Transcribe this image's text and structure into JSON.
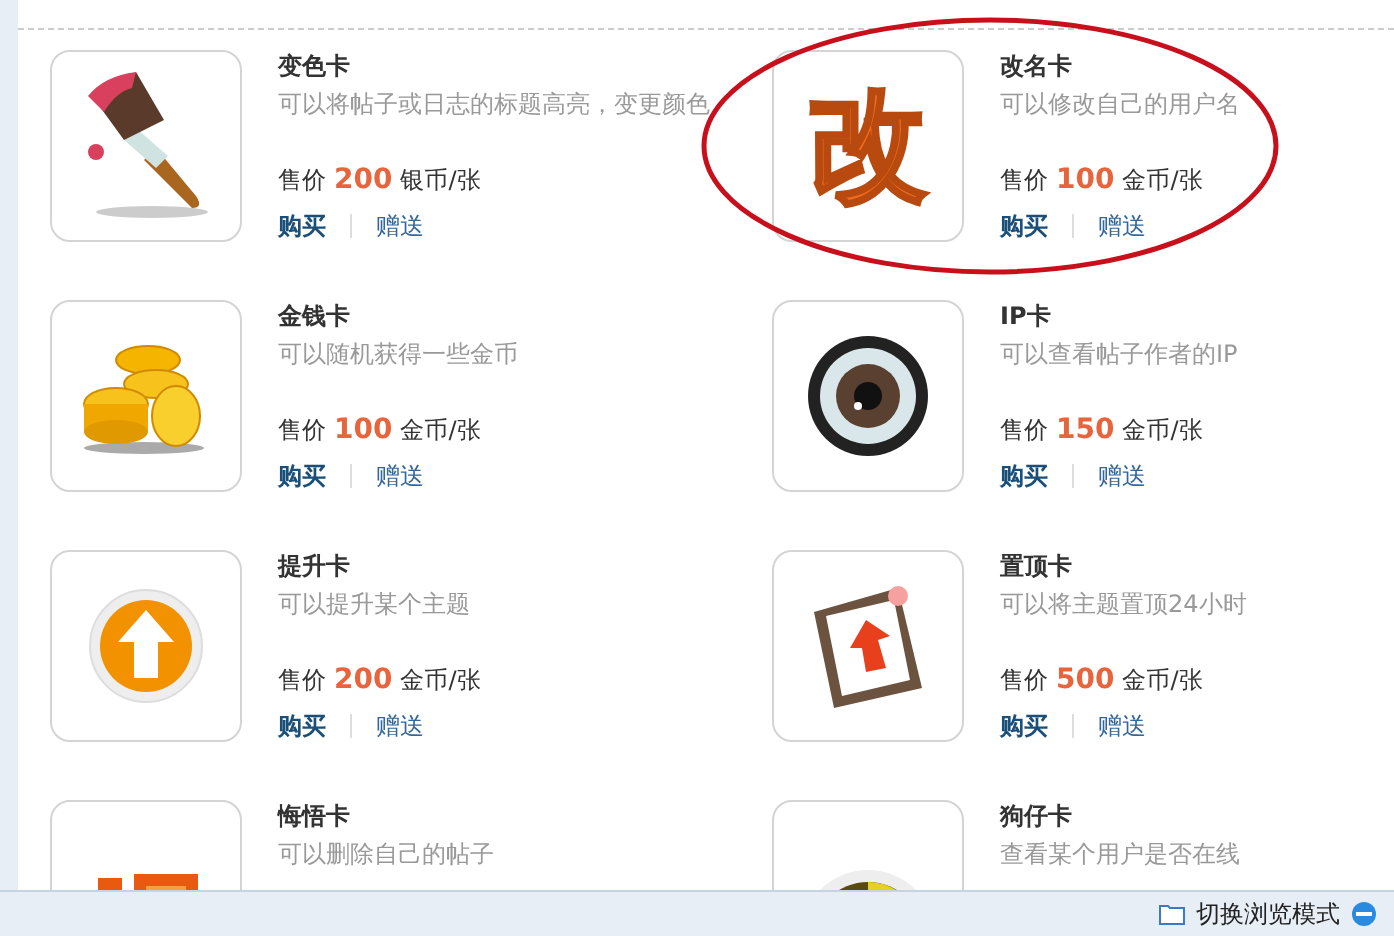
{
  "cards": [
    {
      "kind": "brush",
      "name": "变色卡",
      "description": "可以将帖子或日志的标题高亮，变更颜色",
      "price_label": "售价",
      "price": "200",
      "unit": "银币/张",
      "buy": "购买",
      "gift": "赠送"
    },
    {
      "kind": "glyph",
      "glyph": "改",
      "name": "改名卡",
      "description": "可以修改自己的用户名",
      "price_label": "售价",
      "price": "100",
      "unit": "金币/张",
      "buy": "购买",
      "gift": "赠送",
      "circled": true
    },
    {
      "kind": "coins",
      "name": "金钱卡",
      "description": "可以随机获得一些金币",
      "price_label": "售价",
      "price": "100",
      "unit": "金币/张",
      "buy": "购买",
      "gift": "赠送"
    },
    {
      "kind": "eye",
      "name": "IP卡",
      "description": "可以查看帖子作者的IP",
      "price_label": "售价",
      "price": "150",
      "unit": "金币/张",
      "buy": "购买",
      "gift": "赠送"
    },
    {
      "kind": "arrow",
      "name": "提升卡",
      "description": "可以提升某个主题",
      "price_label": "售价",
      "price": "200",
      "unit": "金币/张",
      "buy": "购买",
      "gift": "赠送"
    },
    {
      "kind": "note",
      "name": "置顶卡",
      "description": "可以将主题置顶24小时",
      "price_label": "售价",
      "price": "500",
      "unit": "金币/张",
      "buy": "购买",
      "gift": "赠送"
    },
    {
      "kind": "regret",
      "name": "悔悟卡",
      "description": "可以删除自己的帖子"
    },
    {
      "kind": "radar",
      "name": "狗仔卡",
      "description": "查看某个用户是否在线"
    }
  ],
  "status_bar": {
    "mode_switch": "切换浏览模式"
  }
}
